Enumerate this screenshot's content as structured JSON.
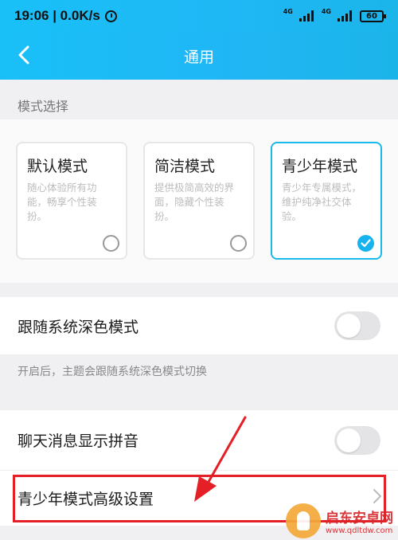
{
  "status_bar": {
    "time": "19:06",
    "speed": " | 0.0K/s",
    "network1": "4G",
    "network2": "4G",
    "battery": "60"
  },
  "header": {
    "title": "通用"
  },
  "mode_section": {
    "label": "模式选择",
    "modes": [
      {
        "title": "默认模式",
        "desc": "随心体验所有功能，畅享个性装扮。",
        "selected": false
      },
      {
        "title": "简洁模式",
        "desc": "提供极简高效的界面，隐藏个性装扮。",
        "selected": false
      },
      {
        "title": "青少年模式",
        "desc": "青少年专属模式，维护纯净社交体验。",
        "selected": true
      }
    ]
  },
  "dark_mode": {
    "label": "跟随系统深色模式",
    "enabled": false,
    "hint": "开启后，主题会跟随系统深色模式切换"
  },
  "pinyin": {
    "label": "聊天消息显示拼音",
    "enabled": false
  },
  "teen_settings": {
    "label": "青少年模式高级设置"
  },
  "watermark": {
    "name": "启东安卓网",
    "url": "www.qdltdw.com"
  },
  "colors": {
    "accent": "#1bb8f4",
    "highlight": "#e51f26"
  }
}
